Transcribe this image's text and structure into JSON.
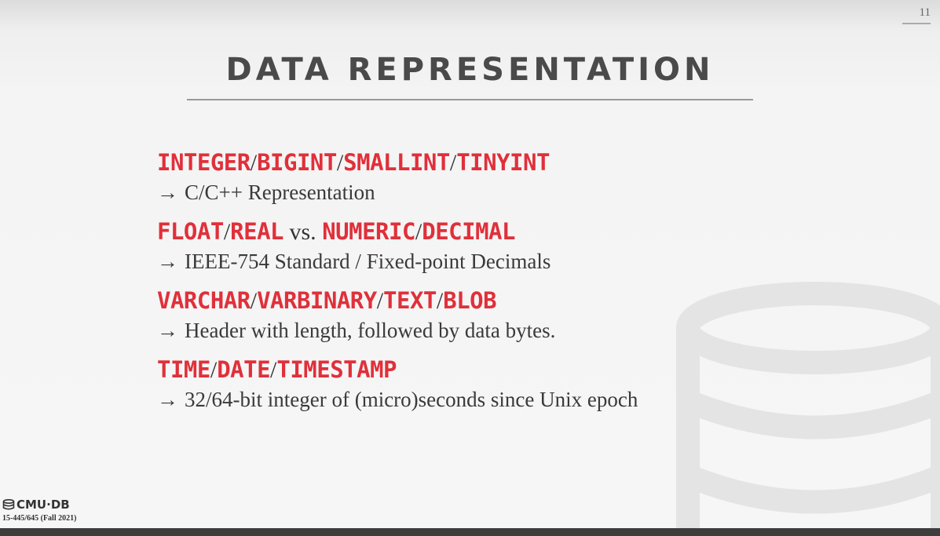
{
  "slide": {
    "page_number": "11",
    "title": "DATA REPRESENTATION"
  },
  "items": [
    {
      "types": [
        "INTEGER",
        "BIGINT",
        "SMALLINT",
        "TINYINT"
      ],
      "detail": "C/C++ Representation"
    },
    {
      "types_a": [
        "FLOAT",
        "REAL"
      ],
      "connector": "vs.",
      "types_b": [
        "NUMERIC",
        "DECIMAL"
      ],
      "detail": "IEEE-754 Standard / Fixed-point Decimals"
    },
    {
      "types": [
        "VARCHAR",
        "VARBINARY",
        "TEXT",
        "BLOB"
      ],
      "detail": "Header with length, followed by data bytes."
    },
    {
      "types": [
        "TIME",
        "DATE",
        "TIMESTAMP"
      ],
      "detail": "32/64-bit integer of (micro)seconds since Unix epoch"
    }
  ],
  "symbols": {
    "separator": "/",
    "arrow": "→"
  },
  "footer": {
    "logo_text": "CMU·DB",
    "course": "15-445/645 (Fall 2021)"
  },
  "colors": {
    "accent": "#e0303a",
    "text": "#3a3a3a",
    "title": "#4a4a4a"
  },
  "icons": {
    "watermark": "database-cylinder-icon",
    "logo": "database-icon"
  }
}
